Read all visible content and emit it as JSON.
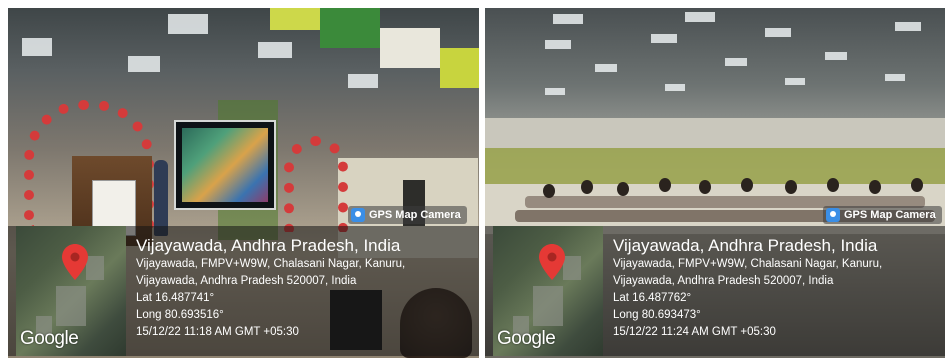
{
  "photos": [
    {
      "id": "left",
      "badge": "GPS Map Camera",
      "title": "Vijayawada, Andhra Pradesh, India",
      "address_line1": "Vijayawada, FMPV+W9W, Chalasani Nagar, Kanuru,",
      "address_line2": "Vijayawada, Andhra Pradesh 520007, India",
      "lat": "Lat 16.487741°",
      "long": "Long 80.693516°",
      "timestamp": "15/12/22 11:18 AM GMT +05:30",
      "map_logo": "Google"
    },
    {
      "id": "right",
      "badge": "GPS Map Camera",
      "title": "Vijayawada, Andhra Pradesh, India",
      "address_line1": "Vijayawada, FMPV+W9W, Chalasani Nagar, Kanuru,",
      "address_line2": "Vijayawada, Andhra Pradesh 520007, India",
      "lat": "Lat 16.487762°",
      "long": "Long 80.693473°",
      "timestamp": "15/12/22 11:24 AM GMT +05:30",
      "map_logo": "Google"
    }
  ],
  "colors": {
    "pin": "#e53935",
    "overlay": "#141414",
    "badge_icon": "#3a8ee6"
  },
  "icons": {
    "badge": "gps-map-camera-icon",
    "pin": "map-pin-icon"
  }
}
